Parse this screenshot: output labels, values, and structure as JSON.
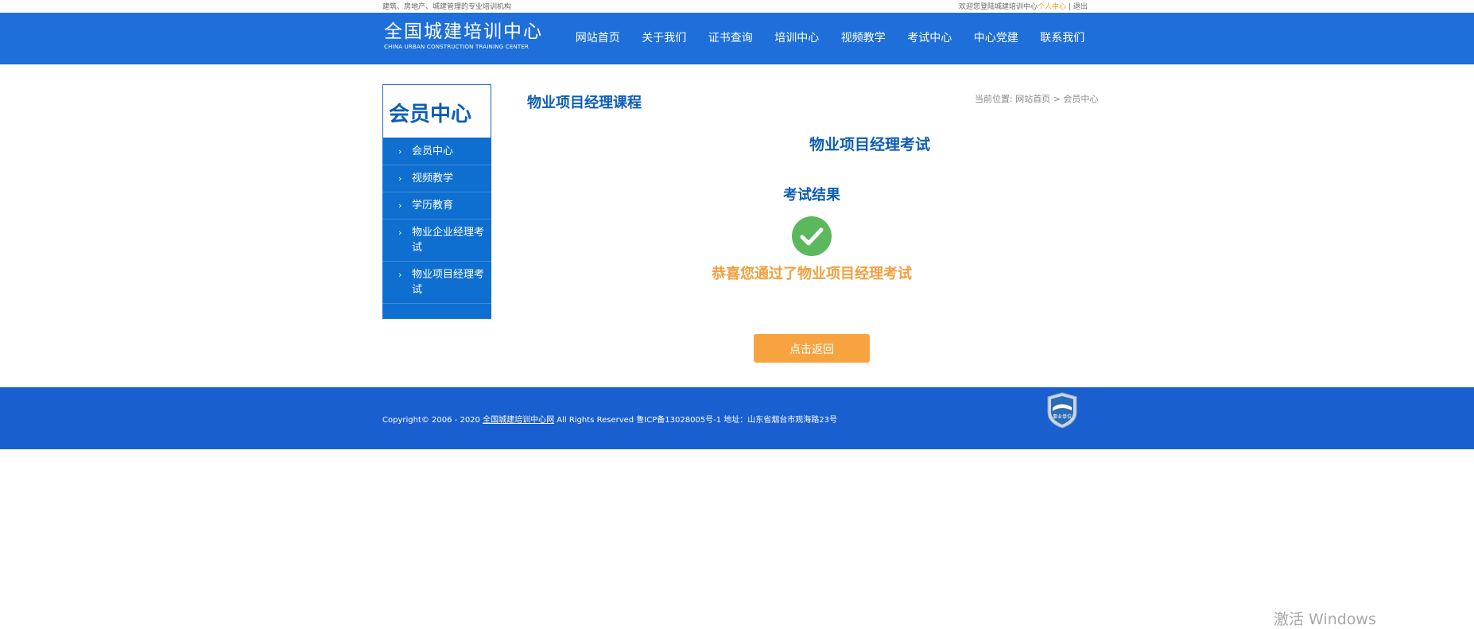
{
  "topbar": {
    "left_text": "建筑、房地产、城建管理的专业培训机构",
    "welcome": "欢迎您登陆城建培训中心",
    "personal_center": "个人中心",
    "separator": "|",
    "logout": "退出"
  },
  "header": {
    "logo_cn": "全国城建培训中心",
    "logo_en": "CHINA URBAN CONSTRUCTION TRAINING CENTER",
    "nav": [
      "网站首页",
      "关于我们",
      "证书查询",
      "培训中心",
      "视频教学",
      "考试中心",
      "中心党建",
      "联系我们"
    ]
  },
  "sidebar": {
    "title": "会员中心",
    "items": [
      "会员中心",
      "视频教学",
      "学历教育",
      "物业企业经理考试",
      "物业项目经理考试"
    ]
  },
  "main": {
    "heading": "物业项目经理课程",
    "breadcrumb_prefix": "当前位置:",
    "breadcrumb_home": "网站首页",
    "breadcrumb_sep": ">",
    "breadcrumb_current": "会员中心",
    "exam_title": "物业项目经理考试",
    "result_title": "考试结果",
    "congrats": "恭喜您通过了物业项目经理考试",
    "back_button": "点击返回"
  },
  "footer": {
    "copyright_prefix": "Copyright© 2006 - 2020",
    "site_link": "全国城建培训中心网",
    "copyright_suffix": "All Rights Reserved 鲁ICP备13028005号-1 地址：山东省烟台市观海路23号",
    "badge_text": "事业单位"
  },
  "watermark": "激活 Windows",
  "colors": {
    "header_blue": "#1e6fd9",
    "footer_blue": "#1a5fd0",
    "title_blue": "#0d5db8",
    "accent_orange": "#f7a440",
    "success_green": "#5cb85c"
  }
}
